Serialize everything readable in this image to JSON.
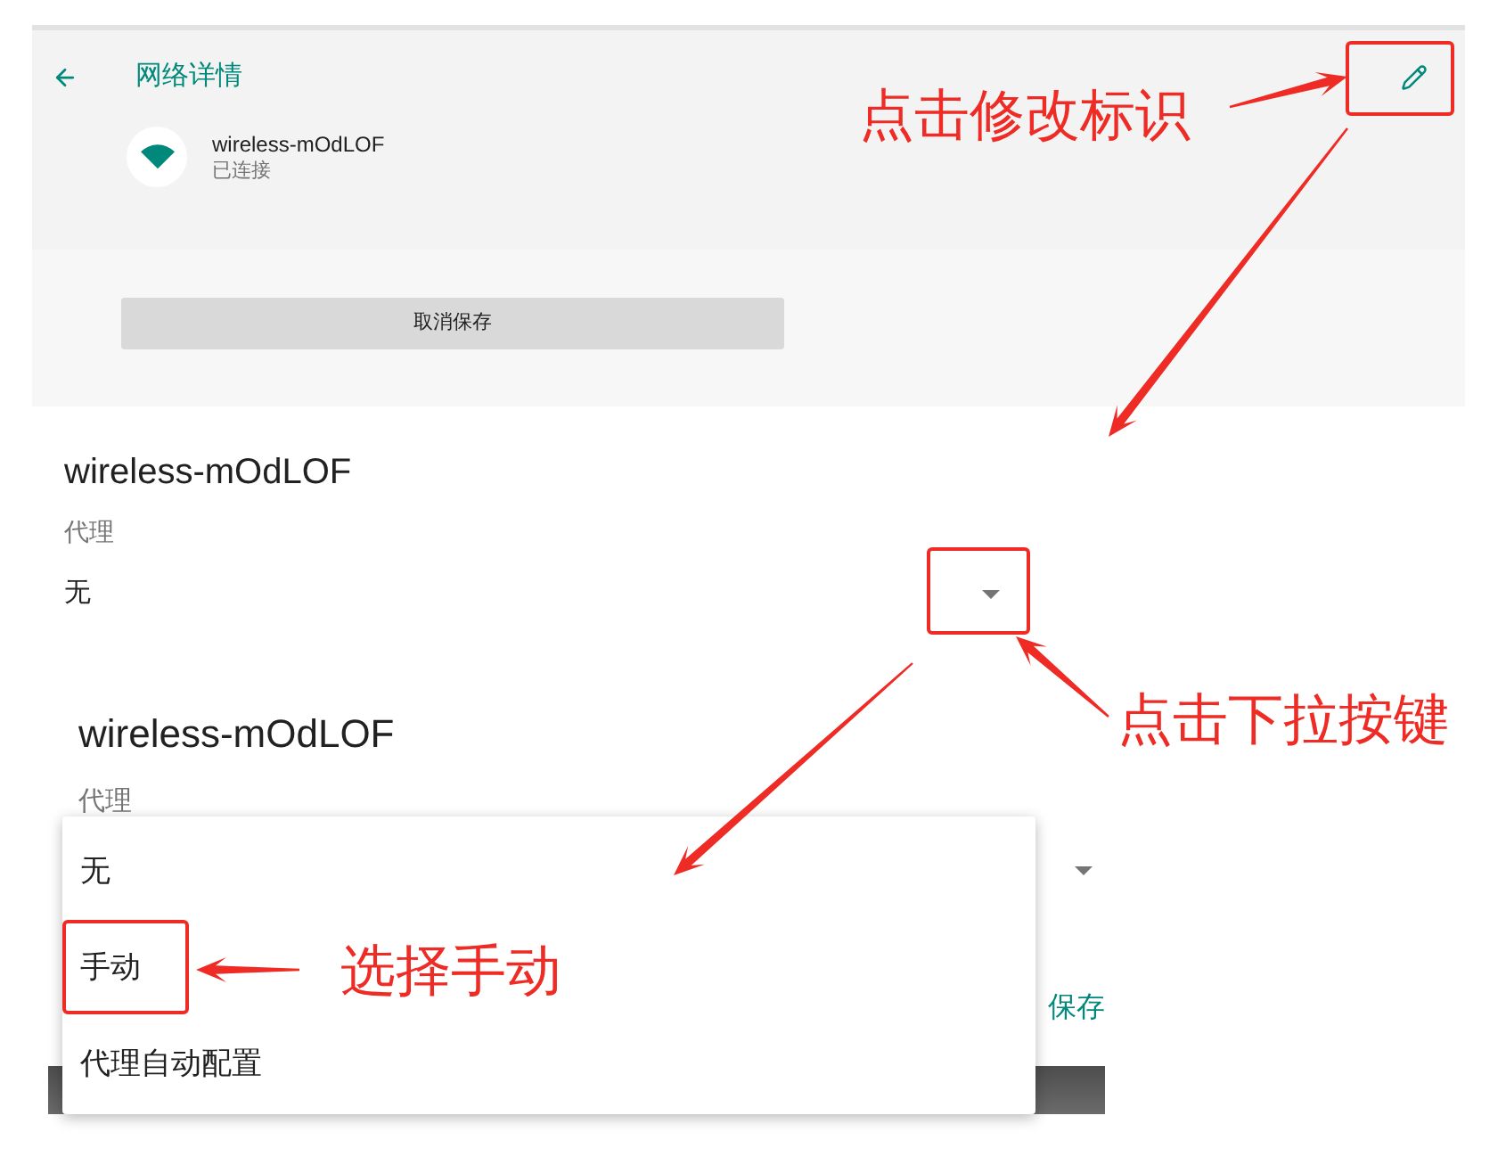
{
  "detail_screen": {
    "title": "网络详情",
    "network": {
      "name": "wireless-mOdLOF",
      "status": "已连接"
    },
    "forget_button": "取消保存"
  },
  "proxy_screen": {
    "title": "wireless-mOdLOF",
    "field_label": "代理",
    "value": "无"
  },
  "proxy_menu_screen": {
    "title": "wireless-mOdLOF",
    "field_label": "代理",
    "options": [
      {
        "label": "无",
        "selected": false
      },
      {
        "label": "手动",
        "selected": false
      },
      {
        "label": "代理自动配置",
        "selected": false
      }
    ],
    "save_button": "保存"
  },
  "annotations": [
    {
      "text": "点击修改标识"
    },
    {
      "text": "点击下拉按键"
    },
    {
      "text": "选择手动"
    }
  ]
}
